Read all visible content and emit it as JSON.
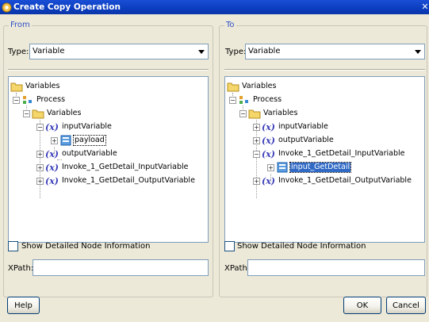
{
  "window": {
    "title": "Create Copy Operation"
  },
  "from": {
    "group_label": "From",
    "type_label": "Type:",
    "type_value": "Variable",
    "tree": [
      {
        "label": "Variables",
        "icon": "folder-icon"
      },
      {
        "label": "Process",
        "icon": "process-icon"
      },
      {
        "label": "Variables",
        "icon": "folder-icon"
      },
      {
        "label": "inputVariable",
        "icon": "variable-icon"
      },
      {
        "label": "payload",
        "icon": "element-icon",
        "state": "focused"
      },
      {
        "label": "outputVariable",
        "icon": "variable-icon"
      },
      {
        "label": "Invoke_1_GetDetail_InputVariable",
        "icon": "variable-icon"
      },
      {
        "label": "Invoke_1_GetDetail_OutputVariable",
        "icon": "variable-icon"
      }
    ],
    "show_detail_label": "Show Detailed Node Information",
    "xpath_label": "XPath:",
    "xpath_value": ""
  },
  "to": {
    "group_label": "To",
    "type_label": "Type:",
    "type_value": "Variable",
    "tree": [
      {
        "label": "Variables",
        "icon": "folder-icon"
      },
      {
        "label": "Process",
        "icon": "process-icon"
      },
      {
        "label": "Variables",
        "icon": "folder-icon"
      },
      {
        "label": "inputVariable",
        "icon": "variable-icon"
      },
      {
        "label": "outputVariable",
        "icon": "variable-icon"
      },
      {
        "label": "Invoke_1_GetDetail_InputVariable",
        "icon": "variable-icon"
      },
      {
        "label": "input_GetDetail",
        "icon": "element-icon",
        "state": "selected"
      },
      {
        "label": "Invoke_1_GetDetail_OutputVariable",
        "icon": "variable-icon"
      }
    ],
    "show_detail_label": "Show Detailed Node Information",
    "xpath_label": "XPath:",
    "xpath_value": ""
  },
  "buttons": {
    "help": "Help",
    "ok": "OK",
    "cancel": "Cancel"
  },
  "colors": {
    "title_bar": "#0b3dbf",
    "group_label": "#2f4fc7",
    "selection": "#316ac5",
    "variable_icon": "#3b3db9"
  }
}
